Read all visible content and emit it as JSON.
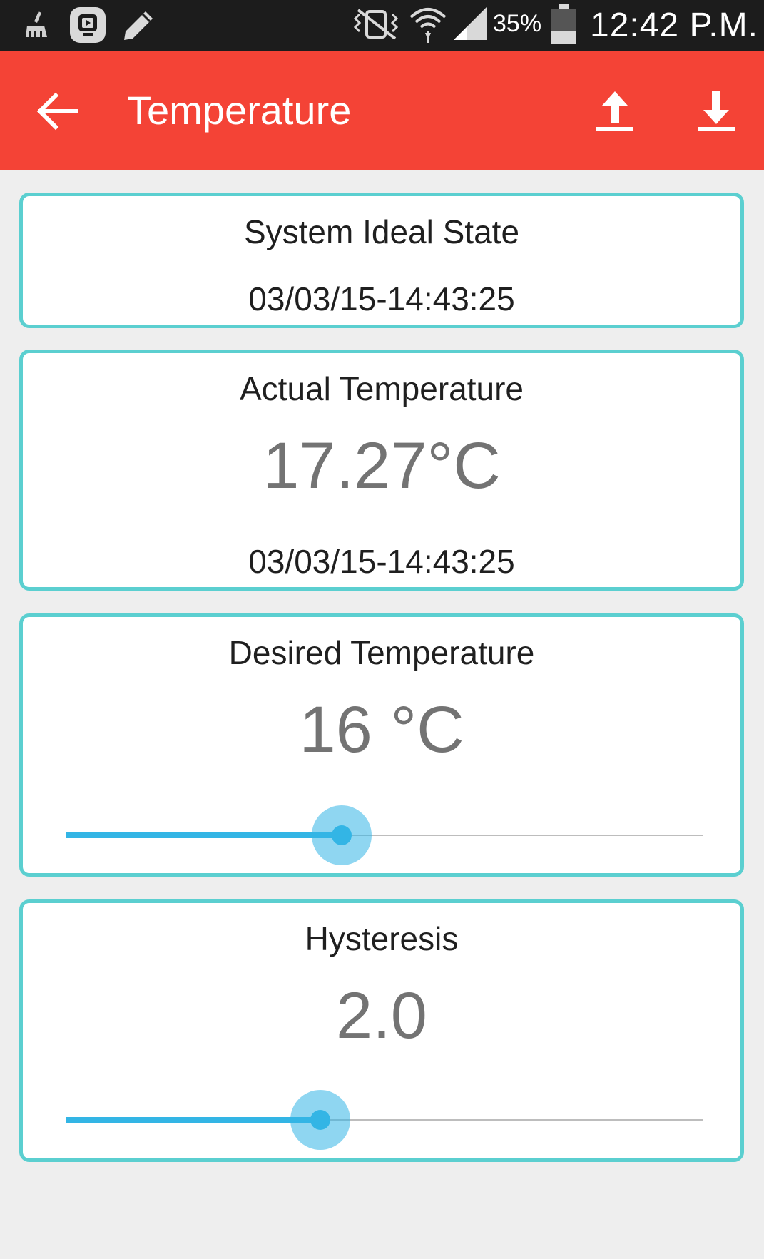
{
  "status_bar": {
    "battery": "35%",
    "time": "12:42 P.M.",
    "icons": [
      "cleaner-icon",
      "app-icon",
      "pencil-icon",
      "vibrate-mute-icon",
      "wifi-icon",
      "signal-icon",
      "battery-icon"
    ]
  },
  "app_bar": {
    "title": "Temperature",
    "color": "#f44336",
    "icons": [
      "back-arrow-icon",
      "upload-icon",
      "download-icon"
    ]
  },
  "cards": {
    "system": {
      "title": "System Ideal State",
      "timestamp": "03/03/15-14:43:25"
    },
    "actual": {
      "title": "Actual Temperature",
      "value": "17.27°C",
      "timestamp": "03/03/15-14:43:25"
    },
    "desired": {
      "title": "Desired Temperature",
      "value": "16 °C",
      "slider_fraction": 0.433
    },
    "hysteresis": {
      "title": "Hysteresis",
      "value": "2.0",
      "slider_fraction": 0.399
    }
  },
  "colors": {
    "card_border": "#5bcfd0",
    "accent": "#33b5e5",
    "background": "#eeeeee"
  }
}
